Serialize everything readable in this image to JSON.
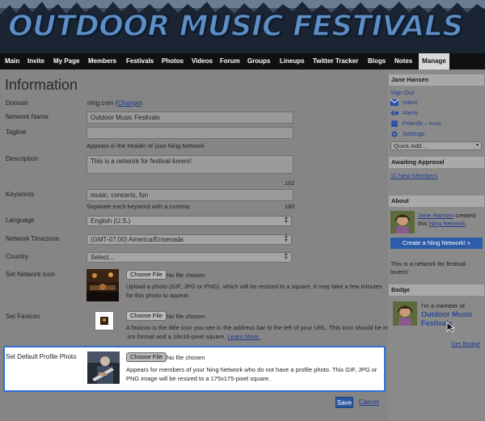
{
  "site": {
    "title": "OUTDOOR MUSIC FESTIVALS"
  },
  "nav": [
    "Main",
    "Invite",
    "My Page",
    "Members",
    "Festivals",
    "Photos",
    "Videos",
    "Forum",
    "Groups",
    "Lineups",
    "Twitter Tracker",
    "Blogs",
    "Notes",
    "Manage"
  ],
  "form": {
    "heading": "Information",
    "domain": {
      "label": "Domain",
      "value": "ning.com",
      "change": "Change"
    },
    "network_name": {
      "label": "Network Name",
      "value": "Outdoor Music Festivals"
    },
    "tagline": {
      "label": "Tagline",
      "value": "",
      "hint": "Appears in the header of your Ning Network"
    },
    "description": {
      "label": "Description",
      "value": "This is a network for festival-lovers!",
      "count": "102"
    },
    "keywords": {
      "label": "Keywords",
      "value": "music, concerts, fun",
      "hint": "Separate each keyword with a comma",
      "count": "180"
    },
    "language": {
      "label": "Language",
      "value": "English (U.S.)"
    },
    "timezone": {
      "label": "Network Timezone",
      "value": "(GMT-07:00) America/Ensenada"
    },
    "country": {
      "label": "Country",
      "value": "Select..."
    },
    "choose_file": "Choose File",
    "no_file": "No file chosen",
    "network_icon": {
      "label": "Set Network Icon",
      "desc": "Upload a photo (GIF, JPG or PNG), which will be resized to a square. It may take a few minutes for this photo to appear."
    },
    "favicon": {
      "label": "Set Favicon",
      "desc": "A favicon is the little icon you see in the address bar to the left of your URL. This icon should be in .ico format and a 16x16-pixel square.",
      "learn_more": "Learn More."
    },
    "profile_photo": {
      "label": "Set Default Profile Photo",
      "desc": "Appears for members of your Ning Network who do not have a profile photo. This GIF, JPG or PNG image will be resized to a 175x175-pixel square."
    },
    "save": "Save",
    "cancel": "Cancel"
  },
  "sidebar": {
    "user": "Jane Hansen",
    "sign_out": "Sign Out",
    "inbox": "Inbox",
    "alerts": "Alerts",
    "friends": "Friends",
    "invite": "– Invite",
    "settings": "Settings",
    "quick_add": "Quick Add...",
    "awaiting": "Awaiting Approval",
    "new_members": "11 New Members",
    "about": "About",
    "about_name": "Jane Hansen",
    "about_created": "created",
    "about_this": "this",
    "about_network": "Ning Network",
    "create_btn": "Create a Ning Network! »",
    "about_text1": "This is a network for festival-",
    "about_text2": "lovers!",
    "badge": "Badge",
    "badge_member": "I'm a member of",
    "badge_line2": "Outdoor Music",
    "badge_line3": "Festivals",
    "get_badge": "Get Badge"
  },
  "colors": {
    "accent": "#2f6fd6",
    "link": "#1e3b8f",
    "nav_bg": "#101010"
  }
}
